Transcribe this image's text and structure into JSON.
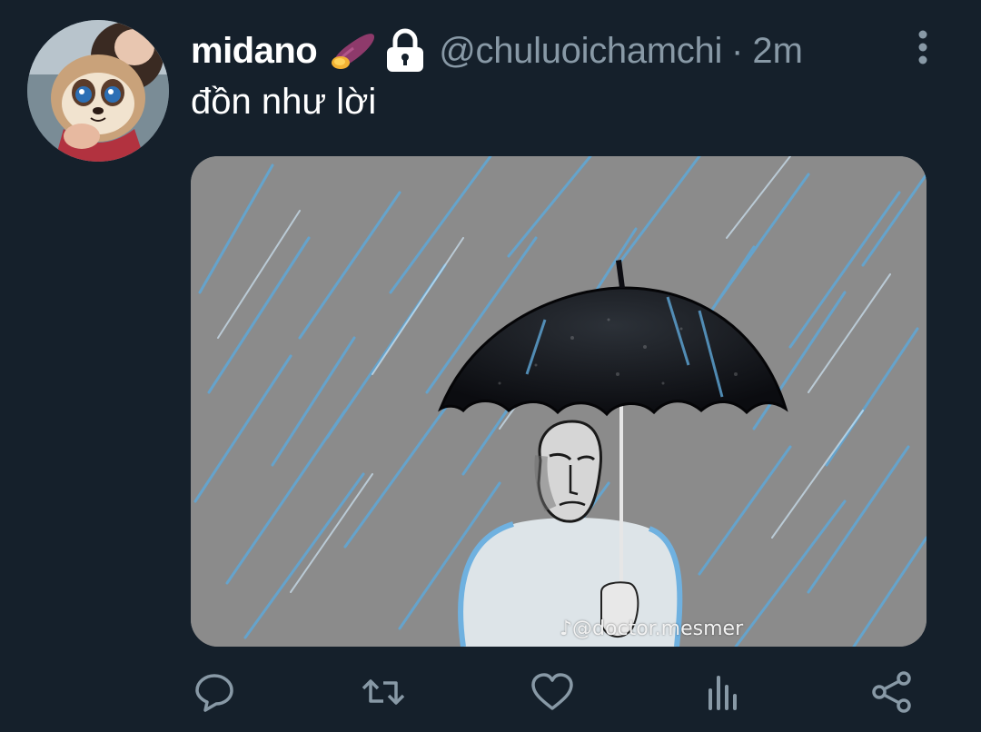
{
  "tweet": {
    "display_name": "midano",
    "badge_emoji_icon": "sweet-potato-icon",
    "protected_icon": "lock-icon",
    "handle": "@chuluoichamchi",
    "separator": "·",
    "timestamp": "2m",
    "text": "đồn như lời",
    "media": {
      "watermark": "@doctor.mesmer",
      "watermark_icon": "tiktok-icon",
      "colors": {
        "background": "#8a8a8a",
        "rain": "#5fa8d8",
        "umbrella": "#0d0d12",
        "figure": "#dfe6ea"
      }
    },
    "actions": [
      {
        "name": "reply",
        "icon": "comment-icon"
      },
      {
        "name": "retweet",
        "icon": "retweet-icon"
      },
      {
        "name": "like",
        "icon": "heart-icon"
      },
      {
        "name": "analytics",
        "icon": "bar-chart-icon"
      },
      {
        "name": "share",
        "icon": "share-icon"
      }
    ]
  },
  "colors": {
    "background": "#15202b",
    "primary_text": "#ffffff",
    "secondary_text": "#8899a6",
    "icon": "#8899a6"
  }
}
